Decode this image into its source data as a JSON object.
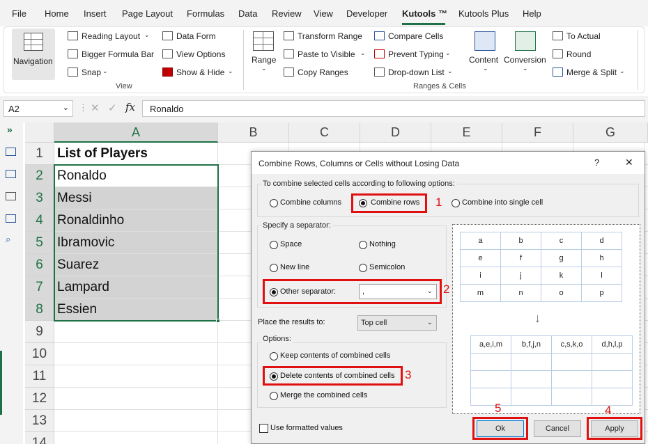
{
  "menu": [
    "File",
    "Home",
    "Insert",
    "Page Layout",
    "Formulas",
    "Data",
    "Review",
    "View",
    "Developer",
    "Kutools ™",
    "Kutools Plus",
    "Help"
  ],
  "ribbon": {
    "navigation": "Navigation",
    "view_group": [
      "Reading Layout",
      "Data Form",
      "Bigger Formula Bar",
      "View Options",
      "Snap",
      "Show & Hide"
    ],
    "view_label": "View",
    "range": "Range",
    "ranges_items": [
      "Transform Range",
      "Compare Cells",
      "Paste to Visible",
      "Prevent Typing",
      "Copy Ranges",
      "Drop-down List"
    ],
    "content": "Content",
    "conversion": "Conversion",
    "more_items": [
      "To Actual",
      "Round",
      "Merge & Split"
    ],
    "ranges_label": "Ranges & Cells"
  },
  "formula_bar": {
    "name_box": "A2",
    "value": "Ronaldo"
  },
  "grid": {
    "columns": [
      "A",
      "B",
      "C",
      "D",
      "E",
      "F",
      "G"
    ],
    "rows": [
      "1",
      "2",
      "3",
      "4",
      "5",
      "6",
      "7",
      "8",
      "9",
      "10",
      "11",
      "12",
      "13",
      "14"
    ],
    "cells": [
      "List of Players",
      "Ronaldo",
      "Messi",
      "Ronaldinho",
      "Ibramovic",
      "Suarez",
      "Lampard",
      "Essien"
    ]
  },
  "dialog": {
    "title": "Combine Rows, Columns or Cells without Losing Data",
    "help": "?",
    "close": "✕",
    "group1": "To combine selected cells according to following options:",
    "combine_columns": "Combine columns",
    "combine_rows": "Combine rows",
    "combine_single": "Combine into single cell",
    "group2": "Specify a separator:",
    "space": "Space",
    "nothing": "Nothing",
    "new_line": "New line",
    "semicolon": "Semicolon",
    "other_separator": "Other separator:",
    "separator_value": ",",
    "place_results": "Place the results to:",
    "place_value": "Top cell",
    "group3": "Options:",
    "keep": "Keep contents of combined cells",
    "delete": "Delete contents of combined cells",
    "merge": "Merge the combined cells",
    "use_formatted": "Use formatted values",
    "ok": "Ok",
    "cancel": "Cancel",
    "apply": "Apply",
    "annotations": [
      "1",
      "2",
      "3",
      "4",
      "5"
    ],
    "preview_top": [
      [
        "a",
        "b",
        "c",
        "d"
      ],
      [
        "e",
        "f",
        "g",
        "h"
      ],
      [
        "i",
        "j",
        "k",
        "l"
      ],
      [
        "m",
        "n",
        "o",
        "p"
      ]
    ],
    "preview_bottom": [
      "a,e,i,m",
      "b,f,j,n",
      "c,s,k,o",
      "d,h,l,p"
    ],
    "arrow": "↓"
  },
  "colors": {
    "accent": "#1e7145",
    "highlight": "#e01010",
    "selection": "#d3d3d3"
  }
}
